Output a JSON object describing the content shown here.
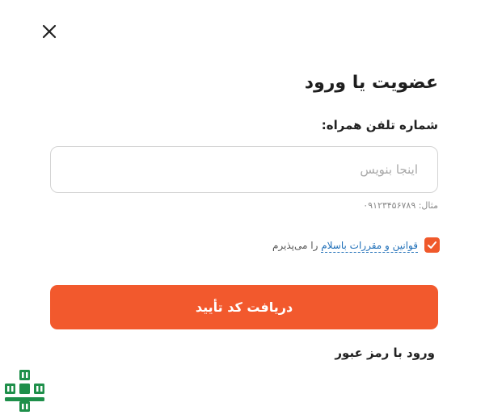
{
  "dialog": {
    "title": "عضویت یا ورود"
  },
  "phone": {
    "label": "شماره تلفن همراه:",
    "placeholder": "اینجا بنویس",
    "value": "",
    "example": "مثال: ۰۹۱۲۳۴۵۶۷۸۹"
  },
  "terms": {
    "checked": true,
    "link_text": "قوانین و مقررات باسلام",
    "suffix_text": " را می‌پذیرم"
  },
  "actions": {
    "submit_label": "دریافت کد تأیید",
    "password_login_label": "ورود با رمز عبور"
  },
  "colors": {
    "accent": "#f2592d",
    "link": "#1f6fb8",
    "logo_green": "#1e8f4a"
  },
  "icons": {
    "close": "close-icon",
    "check": "check-icon",
    "logo": "brand-logo"
  }
}
